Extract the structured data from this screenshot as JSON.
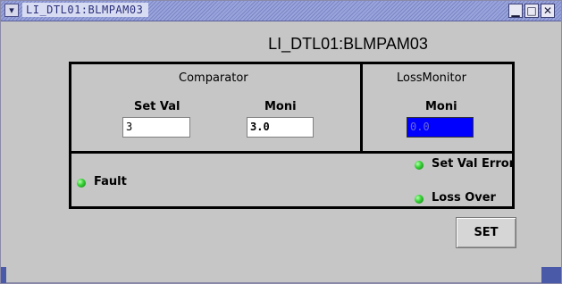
{
  "window": {
    "title": "LI_DTL01:BLMPAM03",
    "menu_icon": "chevron-down-icon",
    "controls": {
      "minimize": "▁",
      "maximize": "□",
      "close": "✕"
    }
  },
  "heading": "LI_DTL01:BLMPAM03",
  "comparator": {
    "title": "Comparator",
    "set_val_label": "Set Val",
    "set_val_value": "3",
    "moni_label": "Moni",
    "moni_value": "3.0"
  },
  "loss_monitor": {
    "title": "LossMonitor",
    "moni_label": "Moni",
    "moni_value": "0.0",
    "moni_bg": "#0000ff"
  },
  "status": {
    "fault": "Fault",
    "set_val_error": "Set Val Error",
    "loss_over": "Loss Over",
    "led_color": "#22c022"
  },
  "buttons": {
    "set": "SET"
  }
}
